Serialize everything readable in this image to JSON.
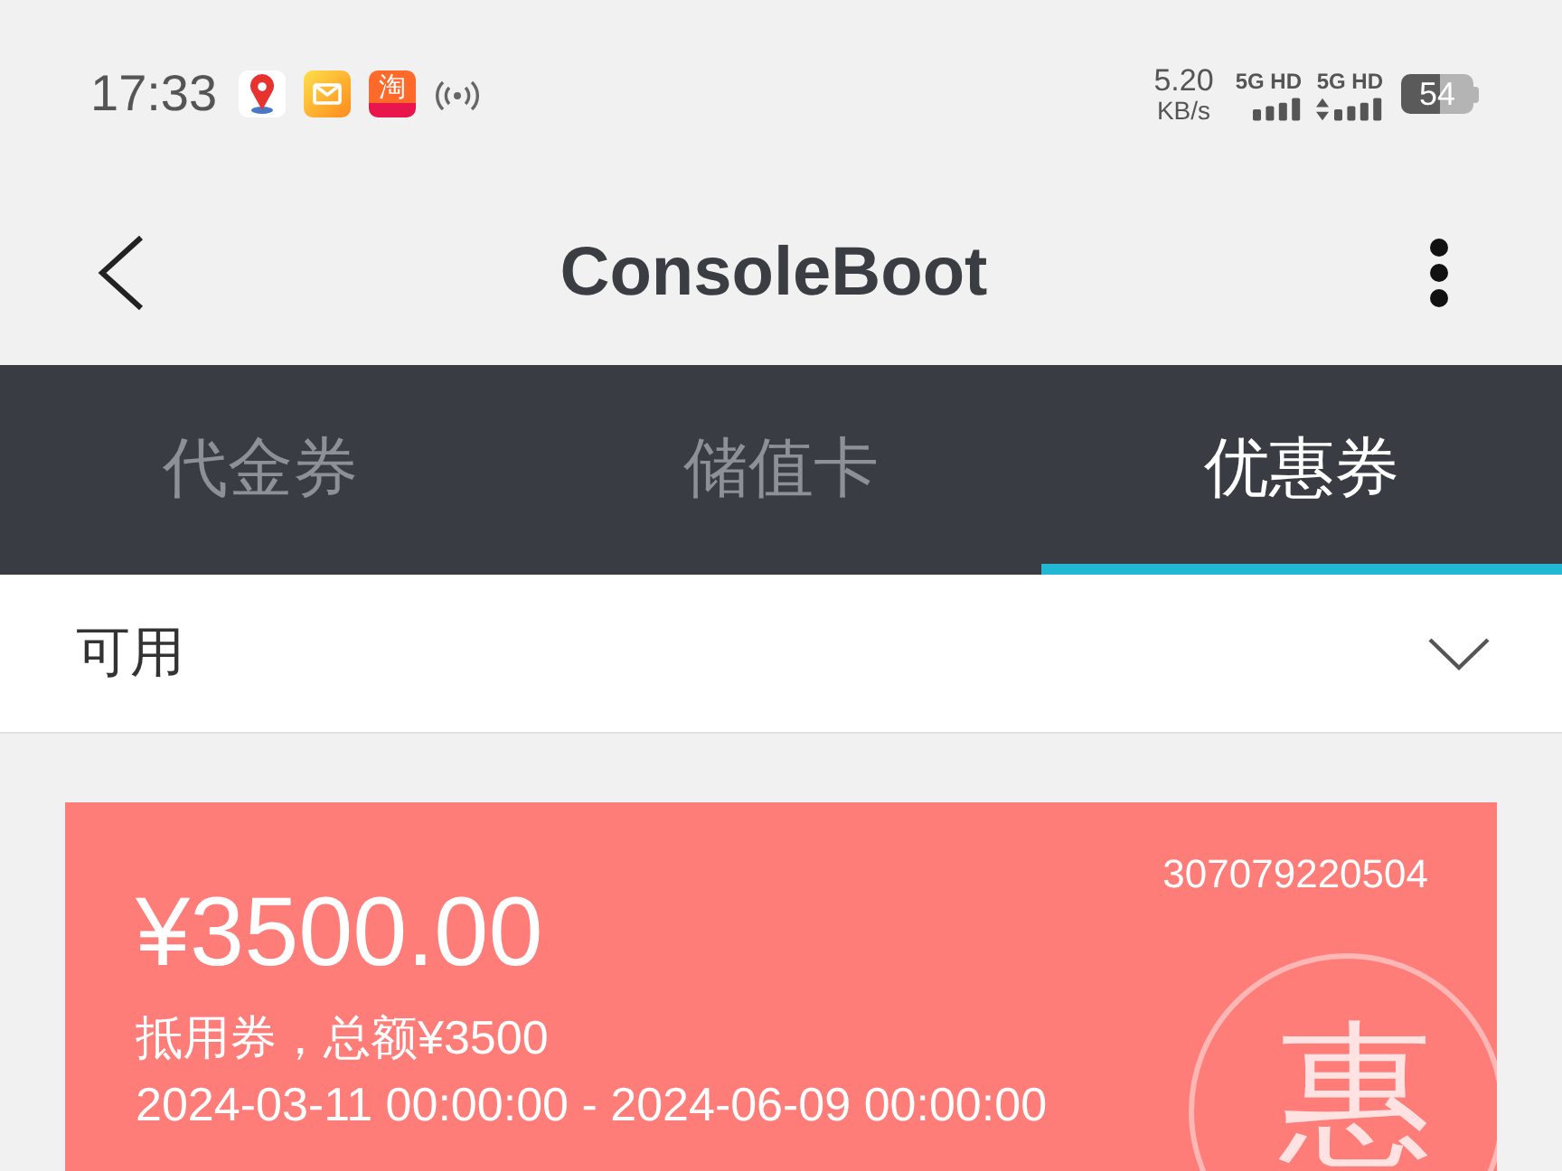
{
  "status_bar": {
    "time": "17:33",
    "notifications": [
      {
        "kind": "map"
      },
      {
        "kind": "mail"
      },
      {
        "kind": "shop",
        "label": "淘"
      },
      {
        "kind": "hotspot"
      }
    ],
    "net_speed": {
      "value": "5.20",
      "unit": "KB/s"
    },
    "signals": [
      {
        "label": "5G HD",
        "kind": "plain"
      },
      {
        "label": "5G HD",
        "kind": "data"
      }
    ],
    "battery": {
      "text": "54"
    }
  },
  "app_bar": {
    "title": "ConsoleBoot"
  },
  "tabs": [
    {
      "label": "代金券",
      "selected": false
    },
    {
      "label": "储值卡",
      "selected": false
    },
    {
      "label": "优惠券",
      "selected": true
    }
  ],
  "filter": {
    "value": "可用",
    "expanded": false
  },
  "coupons": [
    {
      "amount": "¥3500.00",
      "code": "307079220504",
      "description": "抵用券，总额¥3500",
      "validity": "2024-03-11 00:00:00 - 2024-06-09 00:00:00",
      "stamp": "惠"
    }
  ]
}
